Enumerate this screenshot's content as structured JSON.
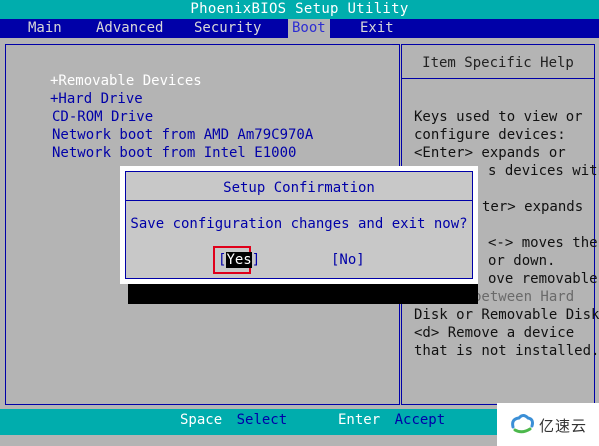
{
  "title": "PhoenixBIOS Setup Utility",
  "menu": {
    "items": [
      "Main",
      "Advanced",
      "Security",
      "Boot",
      "Exit"
    ],
    "active": "Boot"
  },
  "boot_list": [
    "+Removable Devices",
    "+Hard Drive",
    "CD-ROM Drive",
    "Network boot from AMD Am79C970A",
    "Network boot from Intel E1000"
  ],
  "help": {
    "title": "Item Specific Help",
    "lines_visible": [
      "Keys used to view or",
      "configure devices:",
      "<Enter> expands or",
      "s devices with",
      "ter> expands",
      "<-> moves the",
      "or down.",
      "ove removable",
      "device between Hard",
      "Disk or Removable Disk",
      "<d> Remove a device",
      "that is not installed."
    ]
  },
  "dialog": {
    "title": "Setup Confirmation",
    "message": "Save configuration changes and exit now?",
    "yes_open": "[",
    "yes_selected": "Yes",
    "yes_close": "]",
    "no_label": "[No]"
  },
  "bottom_bar": {
    "keys": [
      {
        "key": "Space",
        "action": "Select"
      },
      {
        "key": "Enter",
        "action": "Accept"
      }
    ]
  },
  "watermark": {
    "text": "亿速云",
    "icon": "yisu-cloud-logo-icon"
  },
  "colors": {
    "title_bar": "#00adad",
    "menu_bar": "#0000a8",
    "body_bg": "#b4b4b4",
    "text_blue": "#0000a8",
    "highlight_red": "#e0001a"
  }
}
